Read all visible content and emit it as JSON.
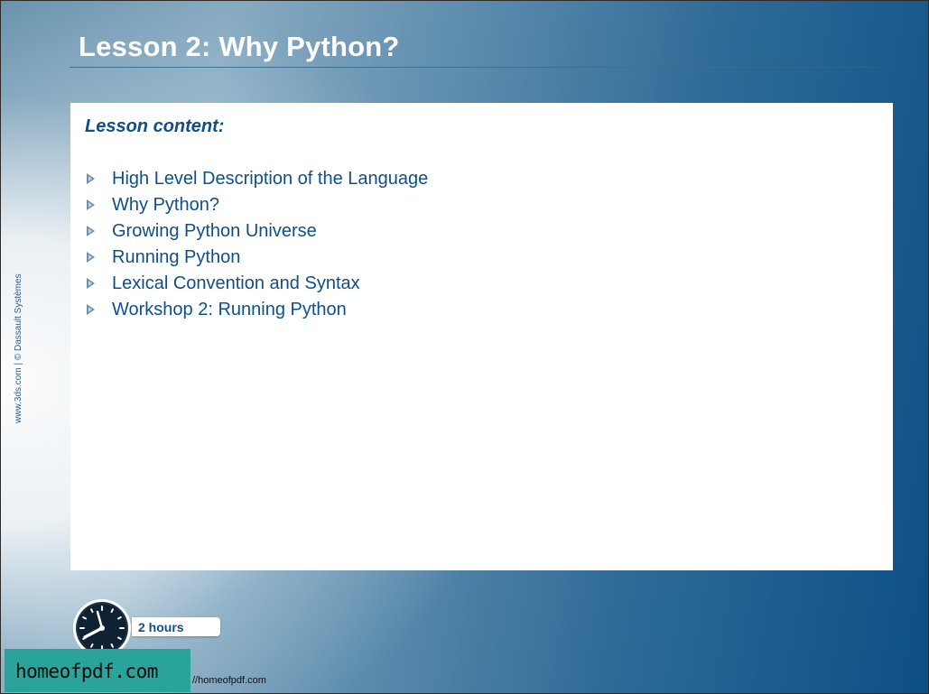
{
  "slide": {
    "title": "Lesson 2: Why Python?",
    "side_text": "www.3ds.com | © Dassault Systèmes",
    "content": {
      "heading": "Lesson content:",
      "items": [
        {
          "label": "High Level Description of the Language"
        },
        {
          "label": "Why Python?"
        },
        {
          "label": "Growing Python Universe"
        },
        {
          "label": "Running Python"
        },
        {
          "label": "Lexical Convention and Syntax"
        },
        {
          "label": "Workshop 2: Running Python"
        }
      ]
    },
    "duration": "2 hours"
  },
  "watermark": {
    "label": "homeofpdf.com",
    "url": "//homeofpdf.com"
  },
  "colors": {
    "accent": "#0f4f86",
    "bullet": "#6f8ea8",
    "watermark_bg": "#2aa39a"
  },
  "icons": {
    "bullet": "triangle-bullet-icon",
    "clock": "clock-icon"
  }
}
